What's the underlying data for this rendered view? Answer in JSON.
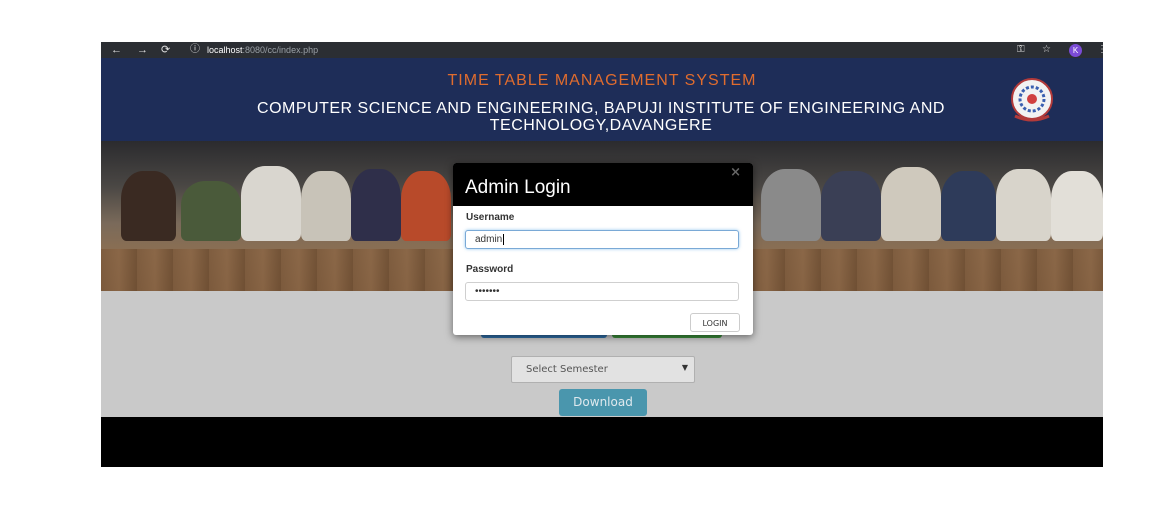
{
  "browser": {
    "url_host": "localhost",
    "url_rest": ":8080/cc/index.php",
    "profile_initial": "K"
  },
  "header": {
    "title": "TIME TABLE MANAGEMENT SYSTEM",
    "subtitle": "COMPUTER SCIENCE AND ENGINEERING, BAPUJI INSTITUTE OF ENGINEERING AND TECHNOLOGY,DAVANGERE"
  },
  "page": {
    "semester_select": "Select Semester",
    "download_label": "Download"
  },
  "modal": {
    "title": "Admin Login",
    "close": "×",
    "username_label": "Username",
    "username_value": "admin",
    "password_label": "Password",
    "password_value": "•••••••",
    "login_label": "LOGIN"
  },
  "colors": {
    "header_bg": "#1e2d58",
    "title_accent": "#e06c2e",
    "download_bg": "#4a96ad"
  },
  "icons": [
    "back-arrow-icon",
    "forward-arrow-icon",
    "reload-icon",
    "info-icon",
    "key-icon",
    "star-icon",
    "menu-icon",
    "college-logo-icon",
    "close-icon",
    "caret-down-icon"
  ]
}
